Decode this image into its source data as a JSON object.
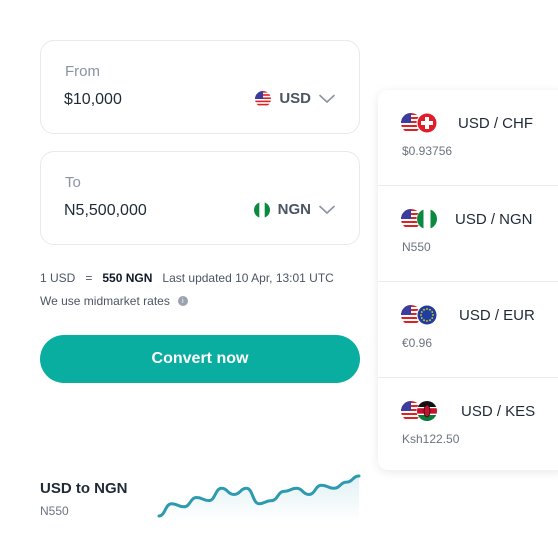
{
  "converter": {
    "from": {
      "label": "From",
      "amount": "$10,000",
      "currency": "USD",
      "flag_icon": "us-flag-icon"
    },
    "to": {
      "label": "To",
      "amount": "N5,500,000",
      "currency": "NGN",
      "flag_icon": "ng-flag-icon"
    },
    "rate": {
      "base": "1 USD",
      "equals": "=",
      "value": "550 NGN",
      "updated": "Last updated 10 Apr, 13:01 UTC"
    },
    "midmarket_note": "We use midmarket rates",
    "convert_label": "Convert now"
  },
  "trend": {
    "title": "USD to NGN",
    "value": "N550",
    "line_color": "#2e9ab0",
    "sparkline_values": [
      0,
      4,
      3,
      6,
      5,
      9,
      7,
      9,
      4,
      5,
      8,
      9,
      7,
      10,
      9,
      11,
      13
    ]
  },
  "pairs": [
    {
      "pair": "USD / CHF",
      "price": "$0.93756",
      "flags": [
        "us-flag-icon",
        "ch-flag-icon"
      ]
    },
    {
      "pair": "USD / NGN",
      "price": "N550",
      "flags": [
        "us-flag-icon",
        "ng-flag-icon"
      ]
    },
    {
      "pair": "USD / EUR",
      "price": "€0.96",
      "flags": [
        "us-flag-icon",
        "eu-flag-icon"
      ]
    },
    {
      "pair": "USD / KES",
      "price": "Ksh122.50",
      "flags": [
        "us-flag-icon",
        "ke-flag-icon"
      ]
    }
  ],
  "colors": {
    "accent": "#0aaea0",
    "text": "#1f2a37",
    "muted": "#8a94a3"
  }
}
